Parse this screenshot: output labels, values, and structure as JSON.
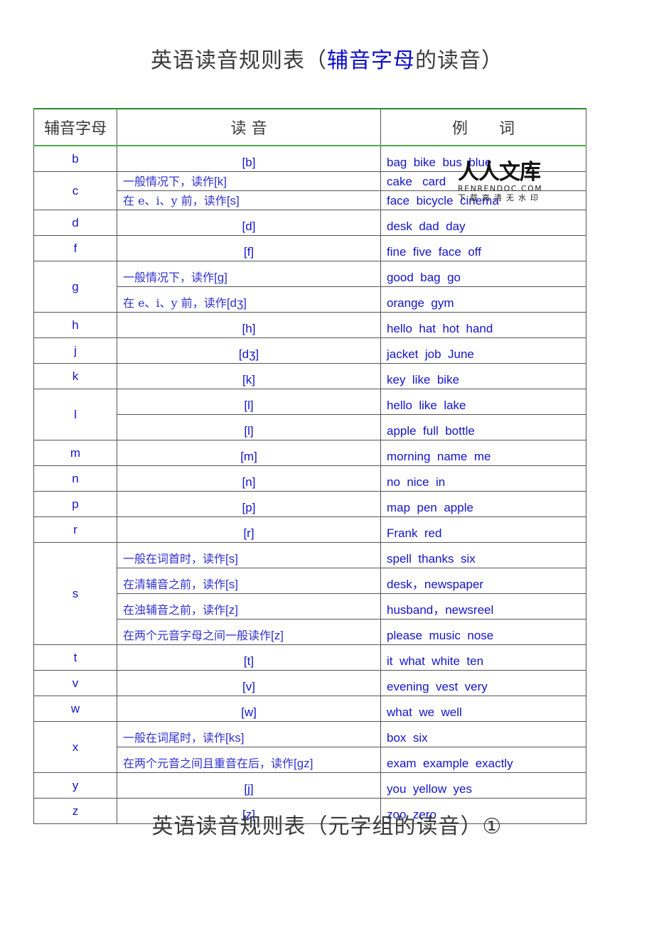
{
  "title1": {
    "prefix": "英语读音规则表（",
    "highlight": "辅音字母",
    "suffix": "的读音）"
  },
  "title2": "英语读音规则表（元字组的读音）①",
  "table": {
    "headers": [
      "辅音字母",
      "读 音",
      "例　　词"
    ],
    "rows": [
      {
        "letter": "b",
        "items": [
          {
            "sound": "[b]",
            "examples": "bag  bike  bus  blue"
          }
        ]
      },
      {
        "letter": "c",
        "items": [
          {
            "rule": "一般情况下，读作",
            "ipa": "[k]",
            "examples": "cake   card"
          },
          {
            "rule": "在 e、i、y 前，读作",
            "ipa": "[s]",
            "examples": "face  bicycle  cinema"
          }
        ]
      },
      {
        "letter": "d",
        "items": [
          {
            "sound": "[d]",
            "examples": "desk  dad  day"
          }
        ]
      },
      {
        "letter": "f",
        "items": [
          {
            "sound": "[f]",
            "examples": "fine  five  face  off"
          }
        ]
      },
      {
        "letter": "g",
        "items": [
          {
            "rule": "一般情况下，读作",
            "ipa": "[g]",
            "examples": "good  bag  go"
          },
          {
            "rule": "在 e、i、y 前，读作",
            "ipa": "[dʒ]",
            "examples": "orange  gym"
          }
        ]
      },
      {
        "letter": "h",
        "items": [
          {
            "sound": "[h]",
            "examples": "hello  hat  hot  hand"
          }
        ]
      },
      {
        "letter": "j",
        "items": [
          {
            "sound": "[dʒ]",
            "examples": "jacket  job  June"
          }
        ]
      },
      {
        "letter": "k",
        "items": [
          {
            "sound": "[k]",
            "examples": "key  like  bike"
          }
        ]
      },
      {
        "letter": "l",
        "items": [
          {
            "sound": "[l]",
            "examples": "hello  like  lake"
          },
          {
            "sound": "[l]",
            "examples": "apple  full  bottle"
          }
        ]
      },
      {
        "letter": "m",
        "items": [
          {
            "sound": "[m]",
            "examples": "morning  name  me"
          }
        ]
      },
      {
        "letter": "n",
        "items": [
          {
            "sound": "[n]",
            "examples": "no  nice  in"
          }
        ]
      },
      {
        "letter": "p",
        "items": [
          {
            "sound": "[p]",
            "examples": "map  pen  apple"
          }
        ]
      },
      {
        "letter": "r",
        "items": [
          {
            "sound": "[r]",
            "examples": "Frank  red"
          }
        ]
      },
      {
        "letter": "s",
        "items": [
          {
            "rule": "一般在词首时，读作",
            "ipa": "[s]",
            "examples": "spell  thanks  six"
          },
          {
            "rule": "在清辅音之前，读作",
            "ipa": "[s]",
            "examples": "desk，newspaper"
          },
          {
            "rule": "在浊辅音之前，读作",
            "ipa": "[z]",
            "examples": "husband，newsreel"
          },
          {
            "rule": "在两个元音字母之间一般读作",
            "ipa": "[z]",
            "examples": "please  music  nose"
          }
        ]
      },
      {
        "letter": "t",
        "items": [
          {
            "sound": "[t]",
            "examples": "it  what  white  ten"
          }
        ]
      },
      {
        "letter": "v",
        "items": [
          {
            "sound": "[v]",
            "examples": "evening  vest  very"
          }
        ]
      },
      {
        "letter": "w",
        "items": [
          {
            "sound": "[w]",
            "examples": "what  we  well"
          }
        ]
      },
      {
        "letter": "x",
        "items": [
          {
            "rule": "一般在词尾时，读作",
            "ipa": "[ks]",
            "examples": "box  six"
          },
          {
            "rule": "在两个元音之间且重音在后，读作",
            "ipa": "[gz]",
            "examples": "exam  example  exactly"
          }
        ]
      },
      {
        "letter": "y",
        "items": [
          {
            "sound": "[j]",
            "examples": "you  yellow  yes"
          }
        ]
      },
      {
        "letter": "z",
        "items": [
          {
            "sound": "[z]",
            "examples": "zoo  zero"
          }
        ]
      }
    ]
  },
  "watermark": {
    "brand": "人人文库",
    "url": "RENRENDOC.COM",
    "tagline": "下载高清无水印"
  }
}
